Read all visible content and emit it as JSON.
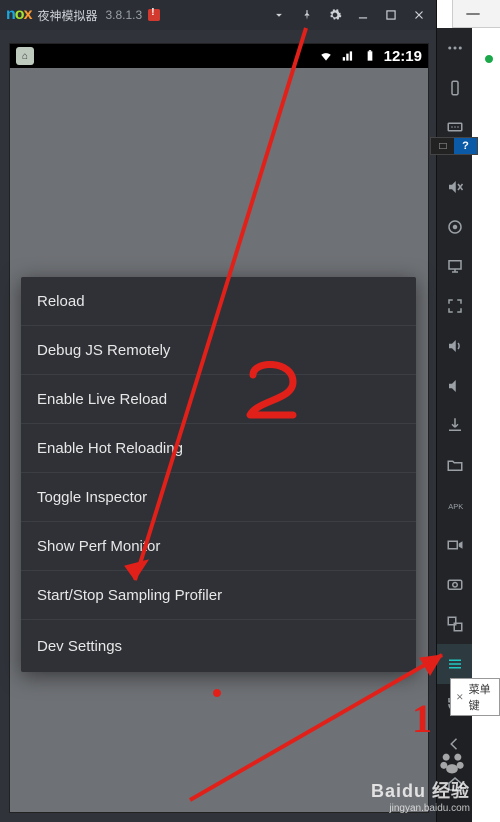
{
  "nox": {
    "title": "夜神模拟器",
    "version": "3.8.1.3",
    "titlebar_buttons": [
      "chevron-down",
      "pin",
      "gear",
      "minimize",
      "maximize",
      "close"
    ]
  },
  "android": {
    "clock": "12:19",
    "app_chip": "⌂"
  },
  "dev_menu": {
    "items": [
      "Reload",
      "Debug JS Remotely",
      "Enable Live Reload",
      "Enable Hot Reloading",
      "Toggle Inspector",
      "Show Perf Monitor",
      "Start/Stop Sampling Profiler",
      "Dev Settings"
    ]
  },
  "toolbar": {
    "items": [
      "more",
      "shake",
      "keyboard",
      "null",
      "mute",
      "location",
      "folder",
      "fullscreen",
      "volume-up",
      "volume-down",
      "upload",
      "clipboard",
      "apk",
      "video",
      "screenshot",
      "multi",
      "gamepad",
      "skin",
      "hamburger",
      "rotate",
      "back",
      "home"
    ]
  },
  "context_label": {
    "text": "菜单键"
  },
  "annotations": {
    "num1": "1",
    "num2": "2"
  },
  "watermark": {
    "line1": "Baidu 经验",
    "line2": "jingyan.baidu.com"
  }
}
